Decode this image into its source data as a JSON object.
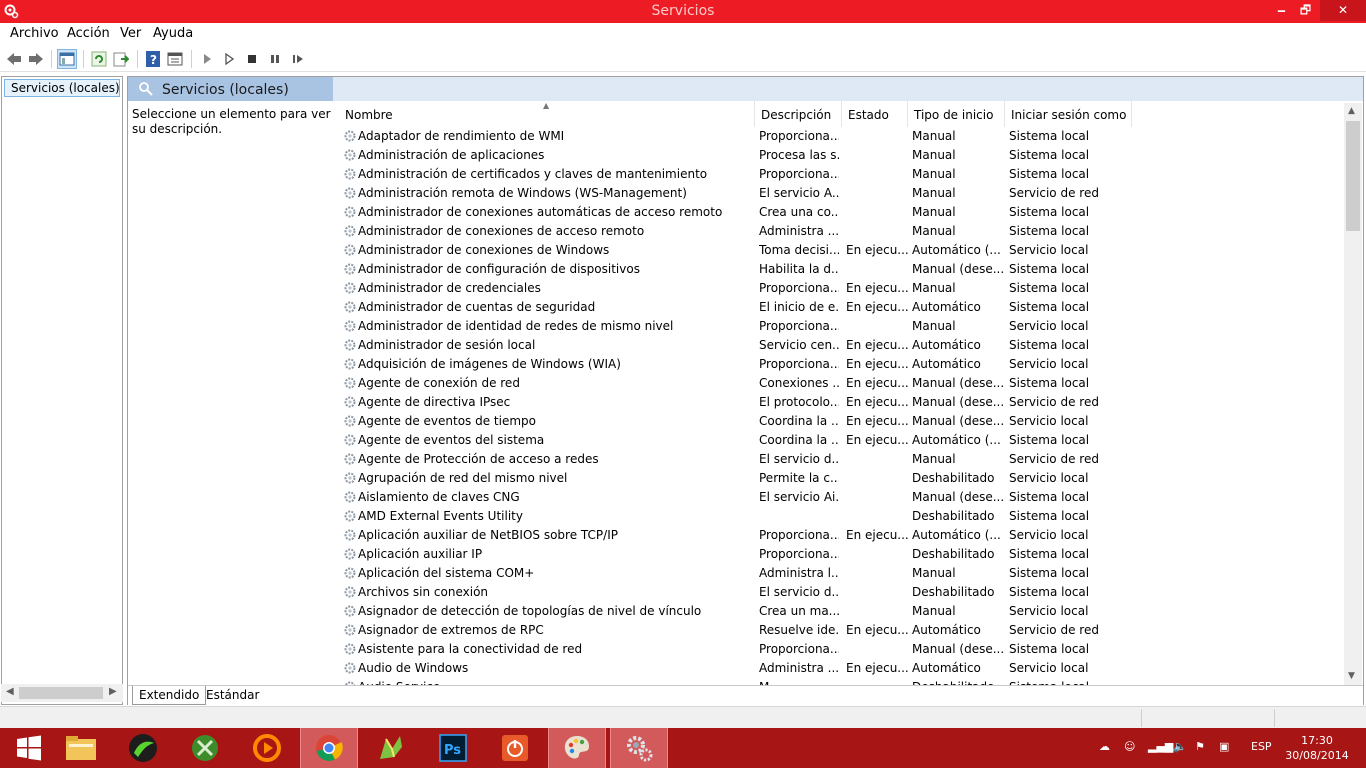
{
  "window": {
    "title": "Servicios",
    "minimize": "🗕",
    "maximize": "🗗",
    "close": "✕"
  },
  "menu": [
    "Archivo",
    "Acción",
    "Ver",
    "Ayuda"
  ],
  "tree": {
    "item": "Servicios (locales)"
  },
  "panel": {
    "header": "Servicios (locales)",
    "description": "Seleccione un elemento para ver su descripción."
  },
  "columns": [
    "Nombre",
    "Descripción",
    "Estado",
    "Tipo de inicio",
    "Iniciar sesión como"
  ],
  "services": [
    [
      "Adaptador de rendimiento de WMI",
      "Proporciona...",
      "",
      "Manual",
      "Sistema local"
    ],
    [
      "Administración de aplicaciones",
      "Procesa las s...",
      "",
      "Manual",
      "Sistema local"
    ],
    [
      "Administración de certificados y claves de mantenimiento",
      "Proporciona...",
      "",
      "Manual",
      "Sistema local"
    ],
    [
      "Administración remota de Windows (WS-Management)",
      "El servicio A...",
      "",
      "Manual",
      "Servicio de red"
    ],
    [
      "Administrador de conexiones automáticas de acceso remoto",
      "Crea una co...",
      "",
      "Manual",
      "Sistema local"
    ],
    [
      "Administrador de conexiones de acceso remoto",
      "Administra ...",
      "",
      "Manual",
      "Sistema local"
    ],
    [
      "Administrador de conexiones de Windows",
      "Toma decisi...",
      "En ejecu...",
      "Automático (...",
      "Servicio local"
    ],
    [
      "Administrador de configuración de dispositivos",
      "Habilita la d...",
      "",
      "Manual (dese...",
      "Sistema local"
    ],
    [
      "Administrador de credenciales",
      "Proporciona...",
      "En ejecu...",
      "Manual",
      "Sistema local"
    ],
    [
      "Administrador de cuentas de seguridad",
      "El inicio de e...",
      "En ejecu...",
      "Automático",
      "Sistema local"
    ],
    [
      "Administrador de identidad de redes de mismo nivel",
      "Proporciona...",
      "",
      "Manual",
      "Servicio local"
    ],
    [
      "Administrador de sesión local",
      "Servicio cen...",
      "En ejecu...",
      "Automático",
      "Sistema local"
    ],
    [
      "Adquisición de imágenes de Windows (WIA)",
      "Proporciona...",
      "En ejecu...",
      "Automático",
      "Servicio local"
    ],
    [
      "Agente de conexión de red",
      "Conexiones ...",
      "En ejecu...",
      "Manual (dese...",
      "Sistema local"
    ],
    [
      "Agente de directiva IPsec",
      "El protocolo...",
      "En ejecu...",
      "Manual (dese...",
      "Servicio de red"
    ],
    [
      "Agente de eventos de tiempo",
      "Coordina la ...",
      "En ejecu...",
      "Manual (dese...",
      "Servicio local"
    ],
    [
      "Agente de eventos del sistema",
      "Coordina la ...",
      "En ejecu...",
      "Automático (...",
      "Sistema local"
    ],
    [
      "Agente de Protección de acceso a redes",
      "El servicio d...",
      "",
      "Manual",
      "Servicio de red"
    ],
    [
      "Agrupación de red del mismo nivel",
      "Permite la c...",
      "",
      "Deshabilitado",
      "Servicio local"
    ],
    [
      "Aislamiento de claves CNG",
      "El servicio Ai...",
      "",
      "Manual (dese...",
      "Sistema local"
    ],
    [
      "AMD External Events Utility",
      "",
      "",
      "Deshabilitado",
      "Sistema local"
    ],
    [
      "Aplicación auxiliar de NetBIOS sobre TCP/IP",
      "Proporciona...",
      "En ejecu...",
      "Automático (...",
      "Servicio local"
    ],
    [
      "Aplicación auxiliar IP",
      "Proporciona...",
      "",
      "Deshabilitado",
      "Sistema local"
    ],
    [
      "Aplicación del sistema COM+",
      "Administra l...",
      "",
      "Manual",
      "Sistema local"
    ],
    [
      "Archivos sin conexión",
      "El servicio d...",
      "",
      "Deshabilitado",
      "Sistema local"
    ],
    [
      "Asignador de detección de topologías de nivel de vínculo",
      "Crea un ma...",
      "",
      "Manual",
      "Servicio local"
    ],
    [
      "Asignador de extremos de RPC",
      "Resuelve ide...",
      "En ejecu...",
      "Automático",
      "Servicio de red"
    ],
    [
      "Asistente para la conectividad de red",
      "Proporciona...",
      "",
      "Manual (dese...",
      "Sistema local"
    ],
    [
      "Audio de Windows",
      "Administra ...",
      "En ejecu...",
      "Automático",
      "Servicio local"
    ],
    [
      "Audio Service",
      "M...",
      "",
      "Deshabilitado",
      "Sistema local"
    ]
  ],
  "tabs": {
    "extended": "Extendido",
    "standard": "Estándar"
  },
  "tray": {
    "lang": "ESP",
    "time": "17:30",
    "date": "30/08/2014"
  },
  "colors": {
    "titlebar": "#ed1c24",
    "taskbar": "#a71515",
    "selection": "#e5f1fb"
  }
}
